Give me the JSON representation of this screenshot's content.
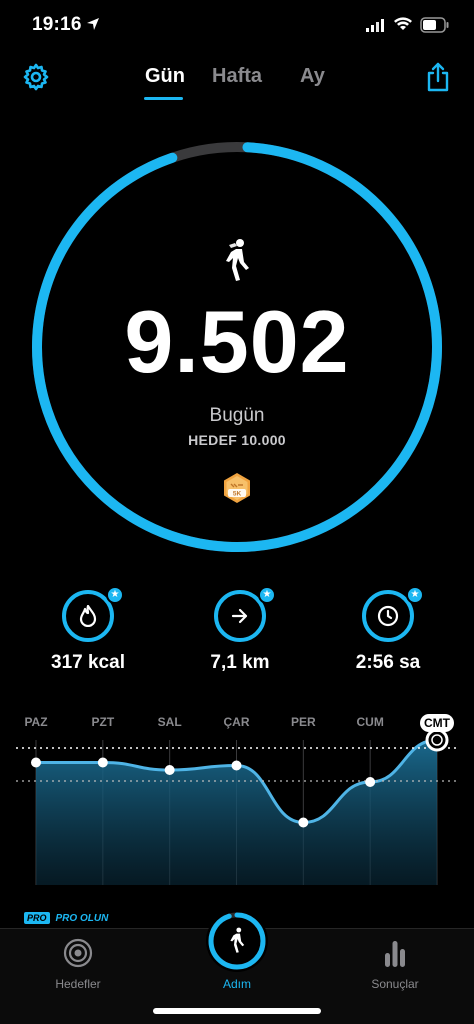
{
  "status_bar": {
    "time": "19:16"
  },
  "nav": {
    "tabs": [
      {
        "label": "Gün",
        "active": true
      },
      {
        "label": "Hafta",
        "active": false
      },
      {
        "label": "Ay",
        "active": false
      }
    ],
    "icons": {
      "left": "gear-icon",
      "right": "share-icon"
    }
  },
  "progress": {
    "steps": "9.502",
    "label": "Bugün",
    "goal": "HEDEF 10.000",
    "fraction": 0.95,
    "badge": "5K",
    "accent": "#1cb7f2"
  },
  "stats": [
    {
      "icon": "flame-icon",
      "value": "317 kcal"
    },
    {
      "icon": "arrow-right-icon",
      "value": "7,1 km"
    },
    {
      "icon": "clock-icon",
      "value": "2:56 sa"
    }
  ],
  "week": {
    "days": [
      "PAZ",
      "PZT",
      "SAL",
      "ÇAR",
      "PER",
      "CUM",
      "CMT"
    ],
    "active_day": "CMT",
    "relative_steps": [
      0.75,
      0.75,
      0.7,
      0.73,
      0.35,
      0.62,
      0.9
    ]
  },
  "promo": {
    "tag": "PRO",
    "text": "PRO OLUN"
  },
  "tabbar": {
    "items": [
      {
        "label": "Hedefler",
        "icon": "target-icon"
      },
      {
        "label": "Adım",
        "icon": "walker-icon",
        "active": true
      },
      {
        "label": "Sonuçlar",
        "icon": "bar-chart-icon"
      }
    ]
  }
}
